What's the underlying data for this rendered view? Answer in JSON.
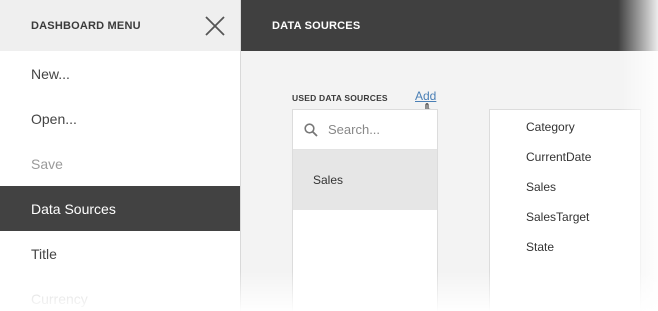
{
  "menu": {
    "title": "DASHBOARD MENU",
    "items": [
      {
        "label": "New...",
        "state": "normal"
      },
      {
        "label": "Open...",
        "state": "normal"
      },
      {
        "label": "Save",
        "state": "disabled"
      },
      {
        "label": "Data Sources",
        "state": "active"
      },
      {
        "label": "Title",
        "state": "normal"
      },
      {
        "label": "Currency",
        "state": "faded"
      }
    ]
  },
  "content": {
    "title": "DATA SOURCES",
    "section_label": "USED DATA SOURCES",
    "add_label": "Add",
    "search_placeholder": "Search...",
    "data_sources": [
      "Sales"
    ],
    "fields": [
      "Category",
      "CurrentDate",
      "Sales",
      "SalesTarget",
      "State"
    ]
  },
  "colors": {
    "menu_active_bg": "#424242",
    "header_dark": "#404040",
    "link": "#4a7fb5"
  }
}
